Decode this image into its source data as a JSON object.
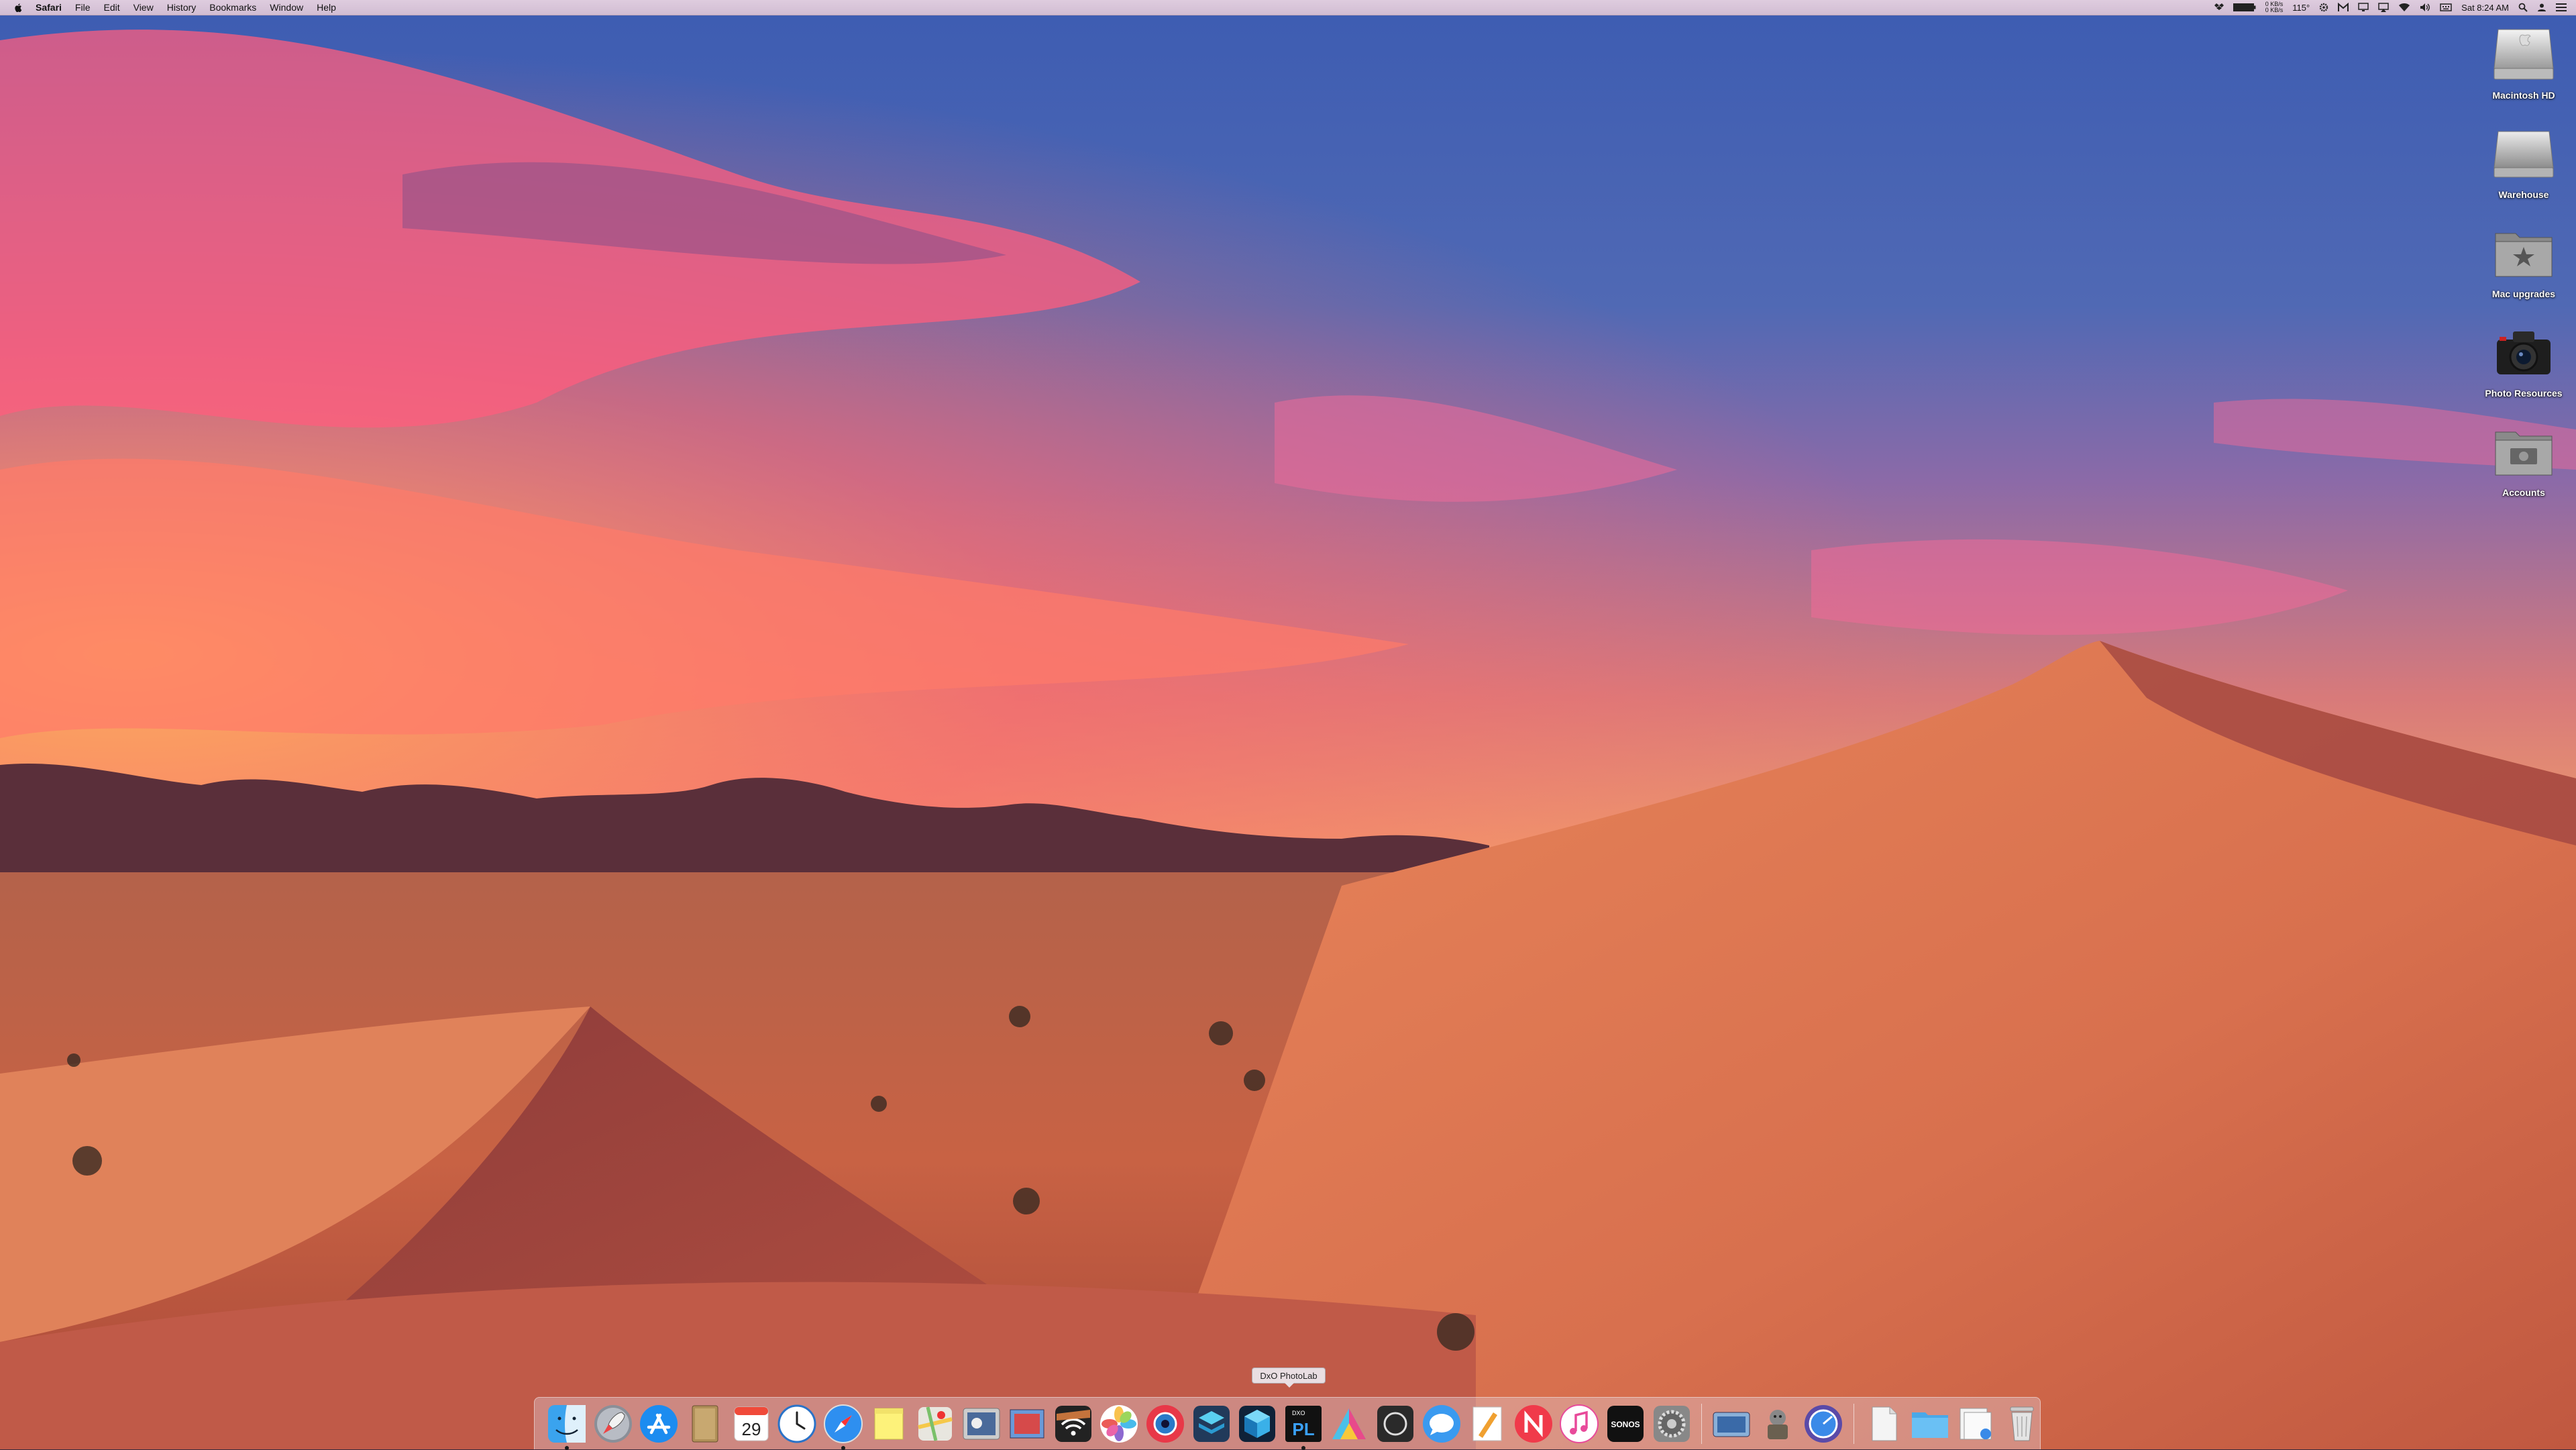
{
  "menubar": {
    "app_name": "Safari",
    "menus": [
      "File",
      "Edit",
      "View",
      "History",
      "Bookmarks",
      "Window",
      "Help"
    ],
    "status": {
      "network_top": "0 KB/s",
      "network_bottom": "0 KB/s",
      "temperature": "115°",
      "clock": "Sat 8:24 AM"
    }
  },
  "desktop_icons": [
    {
      "label": "Macintosh HD",
      "icon": "hard-drive-icon"
    },
    {
      "label": "Warehouse",
      "icon": "external-drive-icon"
    },
    {
      "label": "Mac upgrades",
      "icon": "star-folder-icon"
    },
    {
      "label": "Photo Resources",
      "icon": "camera-icon"
    },
    {
      "label": "Accounts",
      "icon": "dollar-folder-icon"
    }
  ],
  "dock": {
    "tooltip": "DxO PhotoLab",
    "calendar_day": "29",
    "photolab_text": "PL",
    "photolab_small": "DXO",
    "sonos_text": "SONOS"
  }
}
